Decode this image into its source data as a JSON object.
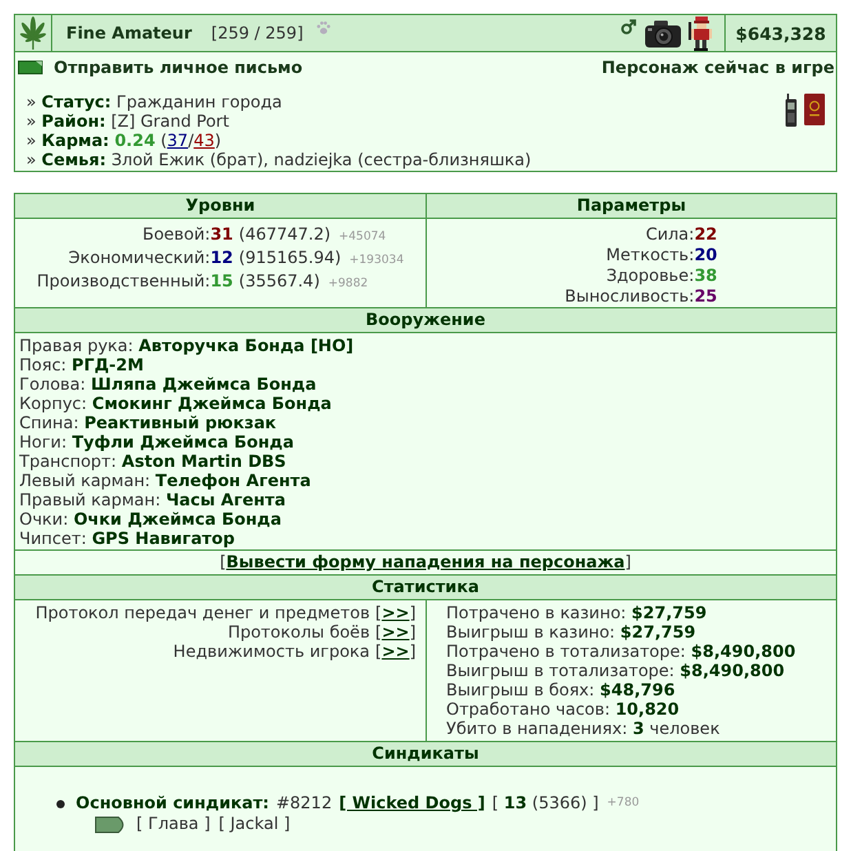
{
  "profile": {
    "name": "Fine Amateur",
    "health": "[259 / 259]",
    "money": "$643,328",
    "send_message": "Отправить личное письмо",
    "online_status": "Персонаж сейчас в игре",
    "info": [
      {
        "kind": "text",
        "text": "» **Статус:** Гражданин города"
      },
      {
        "kind": "text",
        "text": "» **Район:** [Z] Grand Port"
      },
      {
        "kind": "karma",
        "label": "» **Карма:**",
        "value": "0.24",
        "open": "(",
        "plus": "37",
        "sep": "/",
        "minus": "43",
        "close": ")"
      },
      {
        "kind": "text",
        "text": "» **Семья:** Злой Ежик (брат), nadziejka (сестра-близняшка)"
      }
    ]
  },
  "levels": {
    "title": "Уровни",
    "rows": [
      {
        "label": "Боевой:",
        "value": "31",
        "color": "#800000",
        "exp": "(467747.2)",
        "gain": "+45074"
      },
      {
        "label": "Экономический:",
        "value": "12",
        "color": "#000080",
        "exp": "(915165.94)",
        "gain": "+193034"
      },
      {
        "label": "Производственный:",
        "value": "15",
        "color": "#339933",
        "exp": "(35567.4)",
        "gain": "+9882"
      }
    ]
  },
  "parameters": {
    "title": "Параметры",
    "rows": [
      {
        "label": "Сила:",
        "value": "22",
        "color": "#800000"
      },
      {
        "label": "Меткость:",
        "value": "20",
        "color": "#000080"
      },
      {
        "label": "Здоровье:",
        "value": "38",
        "color": "#339933"
      },
      {
        "label": "Выносливость:",
        "value": "25",
        "color": "#660066"
      }
    ]
  },
  "equipment": {
    "title": "Вооружение",
    "items": [
      {
        "slot": "Правая рука:",
        "item": "Авторучка Бонда [НО]"
      },
      {
        "slot": "Пояс:",
        "item": "РГД-2М"
      },
      {
        "slot": "Голова:",
        "item": "Шляпа Джеймса Бонда"
      },
      {
        "slot": "Корпус:",
        "item": "Смокинг Джеймса Бонда"
      },
      {
        "slot": "Спина:",
        "item": "Реактивный рюкзак"
      },
      {
        "slot": "Ноги:",
        "item": "Туфли Джеймса Бонда"
      },
      {
        "slot": "Транспорт:",
        "item": "Aston Martin DBS"
      },
      {
        "slot": "Левый карман:",
        "item": "Телефон Агента"
      },
      {
        "slot": "Правый карман:",
        "item": "Часы Агента"
      },
      {
        "slot": "Очки:",
        "item": "Очки Джеймса Бонда"
      },
      {
        "slot": "Чипсет:",
        "item": "GPS Навигатор"
      }
    ]
  },
  "attack_link": {
    "open": "[",
    "text": "Вывести форму нападения на персонажа",
    "close": "]"
  },
  "statistics": {
    "title": "Статистика",
    "links": [
      {
        "label": "Протокол передач денег и предметов",
        "open": "[",
        "link": ">>",
        "close": "]"
      },
      {
        "label": "Протоколы боёв",
        "open": "[",
        "link": ">>",
        "close": "]"
      },
      {
        "label": "Недвижимость игрока",
        "open": "[",
        "link": ">>",
        "close": "]"
      }
    ],
    "rows": [
      {
        "label": "Потрачено в казино:",
        "value": "$27,759"
      },
      {
        "label": "Выигрыш в казино:",
        "value": "$27,759"
      },
      {
        "label": "Потрачено в тотализаторе:",
        "value": "$8,490,800"
      },
      {
        "label": "Выигрыш в тотализаторе:",
        "value": "$8,490,800"
      },
      {
        "label": "Выигрыш в боях:",
        "value": "$48,796"
      },
      {
        "label": "Отработано часов:",
        "value": "10,820"
      },
      {
        "label": "Убито в нападениях:",
        "value": "3",
        "suffix": "человек"
      }
    ]
  },
  "syndicates": {
    "title": "Синдикаты",
    "items": [
      {
        "label": "Основной синдикат:",
        "number": "#8212",
        "name": "[ Wicked Dogs ]",
        "level": "[ **13** (5366) ]",
        "gain": "+780",
        "roles": [
          "[ Глава ]",
          "[ Jackal ]"
        ]
      }
    ]
  }
}
